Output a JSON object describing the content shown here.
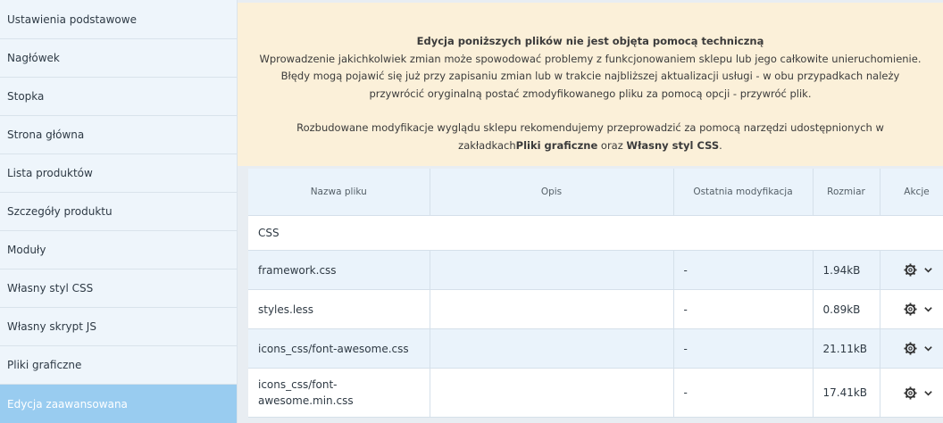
{
  "sidebar": {
    "items": [
      {
        "label": "Ustawienia podstawowe"
      },
      {
        "label": "Nagłówek"
      },
      {
        "label": "Stopka"
      },
      {
        "label": "Strona główna"
      },
      {
        "label": "Lista produktów"
      },
      {
        "label": "Szczegóły produktu"
      },
      {
        "label": "Moduły"
      },
      {
        "label": "Własny styl CSS"
      },
      {
        "label": "Własny skrypt JS"
      },
      {
        "label": "Pliki graficzne"
      },
      {
        "label": "Edycja zaawansowana",
        "active": true
      }
    ]
  },
  "notice": {
    "title": "Edycja poniższych plików nie jest objęta pomocą techniczną",
    "line1": "Wprowadzenie jakichkolwiek zmian może spowodować problemy z funkcjonowaniem sklepu lub jego całkowite unieruchomienie.",
    "line2": "Błędy mogą pojawić się już przy zapisaniu zmian lub w trakcie najbliższej aktualizacji usługi - w obu przypadkach należy przywrócić oryginalną postać zmodyfikowanego pliku za pomocą opcji - przywróć plik.",
    "line3_prefix": "Rozbudowane modyfikacje wyglądu sklepu rekomendujemy przeprowadzić za pomocą narzędzi udostępnionych w zakładkach",
    "link1": "Pliki graficzne",
    "line3_mid": " oraz ",
    "link2": "Własny styl CSS",
    "line3_suffix": "."
  },
  "table": {
    "headers": {
      "name": "Nazwa pliku",
      "desc": "Opis",
      "modified": "Ostatnia modyfikacja",
      "size": "Rozmiar",
      "actions": "Akcje"
    },
    "group": "CSS",
    "rows": [
      {
        "name": "framework.css",
        "desc": "",
        "modified": "-",
        "size": "1.94kB"
      },
      {
        "name": "styles.less",
        "desc": "",
        "modified": "-",
        "size": "0.89kB"
      },
      {
        "name": "icons_css/font-awesome.css",
        "desc": "",
        "modified": "-",
        "size": "21.11kB"
      },
      {
        "name": "icons_css/font-awesome.min.css",
        "desc": "",
        "modified": "-",
        "size": "17.41kB"
      }
    ]
  },
  "colors": {
    "sidebar_bg": "#eef5fb",
    "sidebar_active": "#99ccf0",
    "notice_bg": "#fbf0d9",
    "row_alt": "#eaf3fb"
  },
  "icons": {
    "settings": "gear-icon",
    "dropdown": "chevron-down-icon"
  }
}
